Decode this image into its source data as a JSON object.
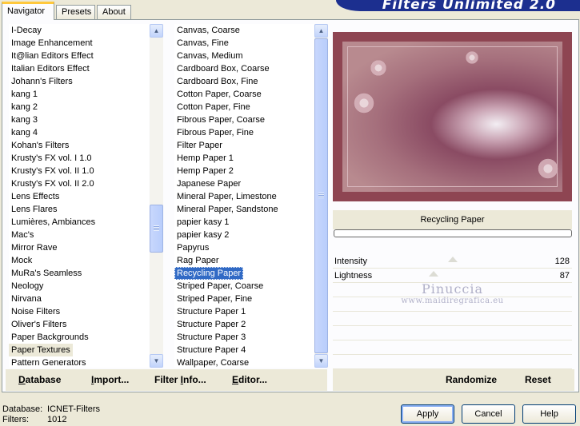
{
  "tabs": [
    {
      "label": "Navigator"
    },
    {
      "label": "Presets"
    },
    {
      "label": "About"
    }
  ],
  "banner": "Filters Unlimited 2.0",
  "categories": {
    "items": [
      "I-Decay",
      "Image Enhancement",
      "It@lian Editors Effect",
      "Italian Editors Effect",
      "Johann's Filters",
      "kang 1",
      "kang 2",
      "kang 3",
      "kang 4",
      "Kohan's Filters",
      "Krusty's FX vol. I 1.0",
      "Krusty's FX vol. II 1.0",
      "Krusty's FX vol. II 2.0",
      "Lens Effects",
      "Lens Flares",
      "Lumières, Ambiances",
      "Mac's",
      "Mirror Rave",
      "Mock",
      "MuRa's Seamless",
      "Neology",
      "Nirvana",
      "Noise Filters",
      "Oliver's Filters",
      "Paper Backgrounds",
      "Paper Textures",
      "Pattern Generators"
    ],
    "selected": "Paper Textures"
  },
  "filters": {
    "items": [
      "Canvas, Coarse",
      "Canvas, Fine",
      "Canvas, Medium",
      "Cardboard Box, Coarse",
      "Cardboard Box, Fine",
      "Cotton Paper, Coarse",
      "Cotton Paper, Fine",
      "Fibrous Paper, Coarse",
      "Fibrous Paper, Fine",
      "Filter Paper",
      "Hemp Paper 1",
      "Hemp Paper 2",
      "Japanese Paper",
      "Mineral Paper, Limestone",
      "Mineral Paper, Sandstone",
      "papier kasy 1",
      "papier kasy 2",
      "Papyrus",
      "Rag Paper",
      "Recycling Paper",
      "Striped Paper, Coarse",
      "Striped Paper, Fine",
      "Structure Paper 1",
      "Structure Paper 2",
      "Structure Paper 3",
      "Structure Paper 4",
      "Wallpaper, Coarse"
    ],
    "selected": "Recycling Paper"
  },
  "preview": {
    "filter_name": "Recycling Paper",
    "params": [
      {
        "label": "Intensity",
        "value": "128",
        "level": 0.5
      },
      {
        "label": "Lightness",
        "value": "87",
        "level": 0.34
      }
    ]
  },
  "watermark": {
    "line1": "Pinuccia",
    "line2": "www.maidiregrafica.eu"
  },
  "left_buttons": {
    "database_u": "D",
    "database_rest": "atabase",
    "import_u": "I",
    "import_rest": "mport...",
    "filterinfo_pre": "Filter ",
    "filterinfo_u": "I",
    "filterinfo_rest": "nfo...",
    "editor_u": "E",
    "editor_rest": "ditor..."
  },
  "right_buttons": {
    "randomize": "Randomize",
    "reset": "Reset"
  },
  "status": {
    "database_label": "Database:",
    "database_value": "ICNET-Filters",
    "filters_label": "Filters:",
    "filters_value": "1012"
  },
  "dialog_buttons": {
    "apply": "Apply",
    "cancel": "Cancel",
    "help": "Help"
  },
  "colors": {
    "selection": "#316ac5",
    "banner": "#1c2f8f"
  }
}
